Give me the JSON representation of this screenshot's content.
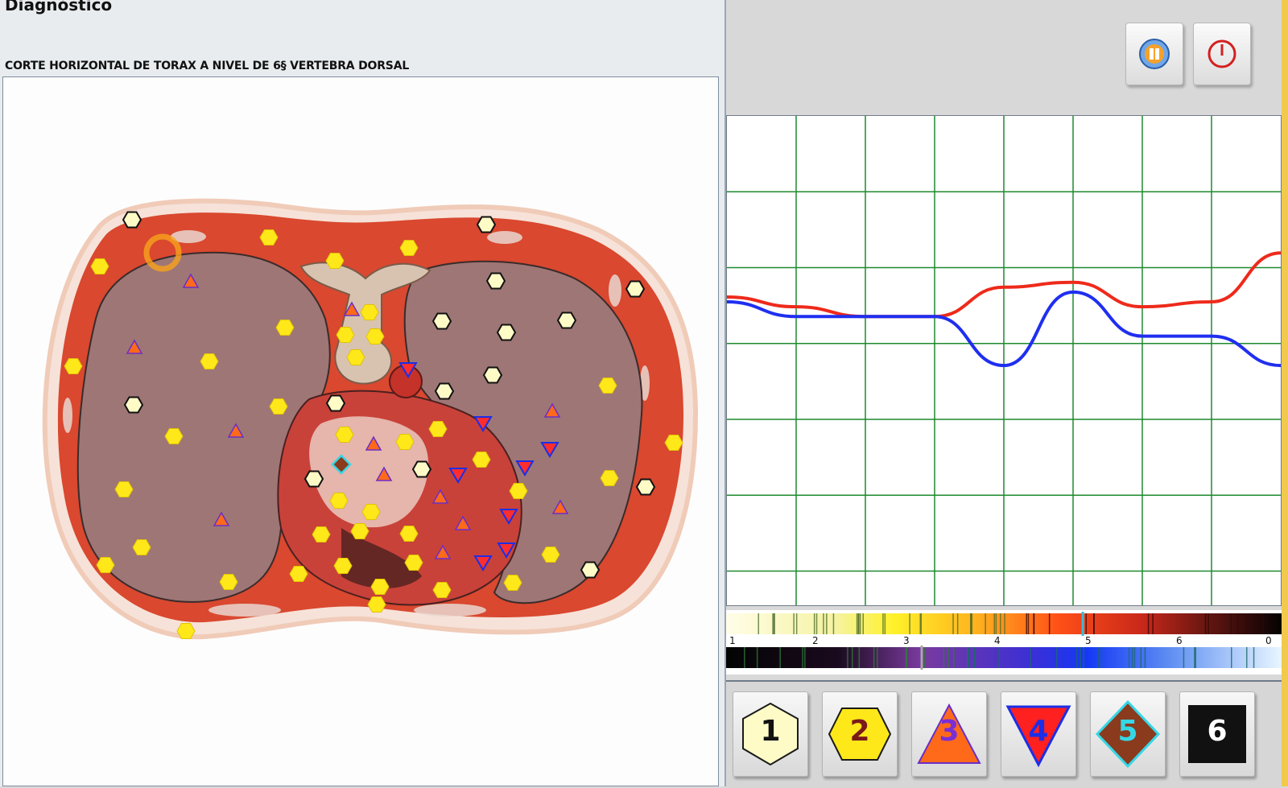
{
  "app": {
    "title": "Diagnóstico"
  },
  "section": {
    "title": "CORTE HORIZONTAL DE TORAX A NIVEL DE 6§ VERTEBRA DORSAL"
  },
  "toolbar": {
    "buttons": [
      {
        "name": "info-button",
        "icon": "media-icon"
      },
      {
        "name": "power-button",
        "icon": "power-icon"
      }
    ]
  },
  "markers": {
    "colors": {
      "level1": "#fffbc7",
      "level2": "#ffe81a",
      "level3": "#ff6a1a",
      "level4": "#ff2d2d",
      "level5": "#8a3a1d"
    }
  },
  "chart_data": {
    "type": "line",
    "grid": true,
    "series": [
      {
        "color": "#ee2a1b",
        "points": [
          [
            0,
            0.37
          ],
          [
            1,
            0.39
          ],
          [
            2,
            0.41
          ],
          [
            3,
            0.41
          ],
          [
            4,
            0.35
          ],
          [
            5,
            0.34
          ],
          [
            6,
            0.39
          ],
          [
            7,
            0.38
          ],
          [
            8,
            0.28
          ]
        ]
      },
      {
        "color": "#1f2ff0",
        "points": [
          [
            0,
            0.38
          ],
          [
            1,
            0.41
          ],
          [
            2,
            0.41
          ],
          [
            3,
            0.41
          ],
          [
            4,
            0.51
          ],
          [
            5,
            0.36
          ],
          [
            6,
            0.45
          ],
          [
            7,
            0.45
          ],
          [
            8,
            0.51
          ]
        ]
      }
    ],
    "x_range": [
      0,
      8
    ],
    "y_range": [
      0,
      1
    ]
  },
  "scale": {
    "labels": [
      "1",
      "2",
      "3",
      "4",
      "5",
      "6",
      "0"
    ],
    "warm_marker": 0.64,
    "cool_marker": 0.35
  },
  "level_buttons": [
    {
      "label": "1",
      "shape": "hexagon",
      "fill": "#fffbc7",
      "text_color": "#111111"
    },
    {
      "label": "2",
      "shape": "hexagon",
      "fill": "#ffe81a",
      "text_color": "#7b1a1a"
    },
    {
      "label": "3",
      "shape": "triangle-up",
      "fill": "#ff6a1a",
      "text_color": "#7a2ed6"
    },
    {
      "label": "4",
      "shape": "triangle-down",
      "fill": "#ff2020",
      "text_color": "#1b2ee8"
    },
    {
      "label": "5",
      "shape": "diamond",
      "fill": "#8a3a1d",
      "text_color": "#35d7e6"
    },
    {
      "label": "6",
      "shape": "square",
      "fill": "#111111",
      "text_color": "#ffffff"
    }
  ]
}
